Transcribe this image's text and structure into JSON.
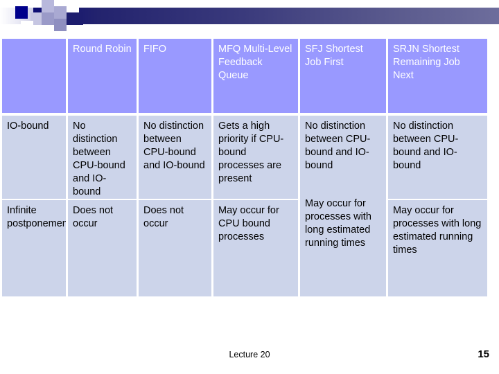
{
  "slide": {
    "decoration": {
      "bar_color_start": "#0d0d73",
      "bar_color_end": "#6d6d9c",
      "accent_square_color": "#00008B"
    },
    "table": {
      "header_bg": "#9999ff",
      "header_text_color": "#ffffff",
      "body_bg": "#ccd4ea",
      "body_text_color": "#000000",
      "columns": [
        {
          "id": "rowlabel",
          "header": ""
        },
        {
          "id": "rr",
          "header": "Round Robin"
        },
        {
          "id": "fifo",
          "header": "FIFO"
        },
        {
          "id": "mfq",
          "header": "MFQ Multi-Level Feedback Queue"
        },
        {
          "id": "sfj",
          "header": "SFJ Shortest Job First"
        },
        {
          "id": "srjn",
          "header": "SRJN Shortest Remaining Job Next"
        }
      ],
      "rows": [
        {
          "label": "IO-bound",
          "rr": "No distinction between CPU-bound and IO-bound",
          "fifo": "No distinction between CPU-bound and IO-bound",
          "mfq": "Gets a high priority if CPU-bound processes are present",
          "srjn": "No distinction between CPU-bound and IO-bound"
        },
        {
          "label": "Infinite postponement",
          "rr": "Does not occur",
          "fifo": "Does not occur",
          "mfq": "May occur for CPU bound processes",
          "srjn": "May occur for processes with long estimated running times"
        }
      ],
      "sfj_merged": {
        "part1": "No distinction between CPU-bound and IO-bound",
        "part2": "May occur for processes with long estimated running times"
      }
    },
    "footer": {
      "center_label": "Lecture 20",
      "page_number": "15"
    }
  }
}
